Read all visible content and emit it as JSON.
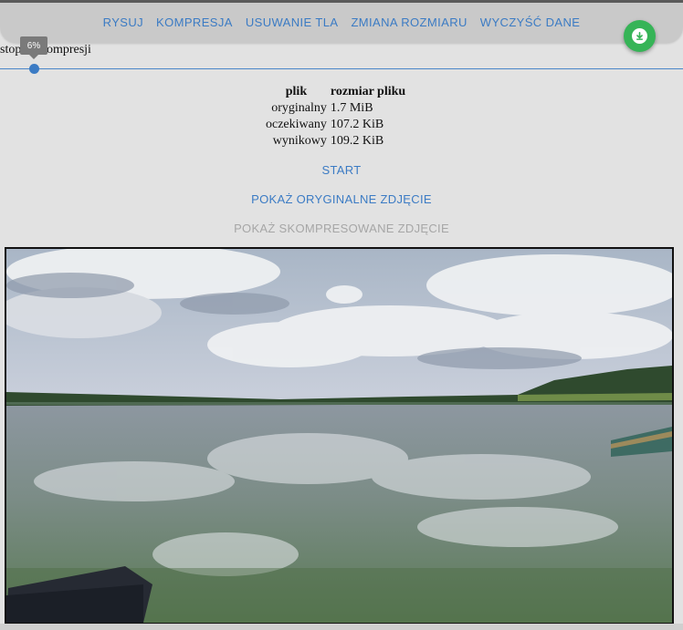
{
  "nav": {
    "items": [
      "RYSUJ",
      "KOMPRESJA",
      "USUWANIE TLA",
      "ZMIANA ROZMIARU",
      "WYCZYŚĆ DANE"
    ]
  },
  "fab": {
    "icon": "download-icon",
    "color": "#36b457"
  },
  "slider": {
    "label": "stopień kompresji",
    "tooltip": "6%",
    "value_percent": 6
  },
  "info_table": {
    "headers": [
      "plik",
      "rozmiar pliku"
    ],
    "rows": [
      {
        "name": "oryginalny",
        "size": "1.7 MiB"
      },
      {
        "name": "oczekiwany",
        "size": "107.2 KiB"
      },
      {
        "name": "wynikowy",
        "size": "109.2 KiB"
      }
    ]
  },
  "actions": {
    "start": "START",
    "show_original": "POKAŻ ORYGINALNE ZDJĘCIE",
    "show_compressed": "POKAŻ SKOMPRESOWANE ZDJĘCIE"
  },
  "colors": {
    "accent": "#3b7bc4",
    "disabled": "#a6a6a6",
    "background": "#e2e2e2"
  }
}
